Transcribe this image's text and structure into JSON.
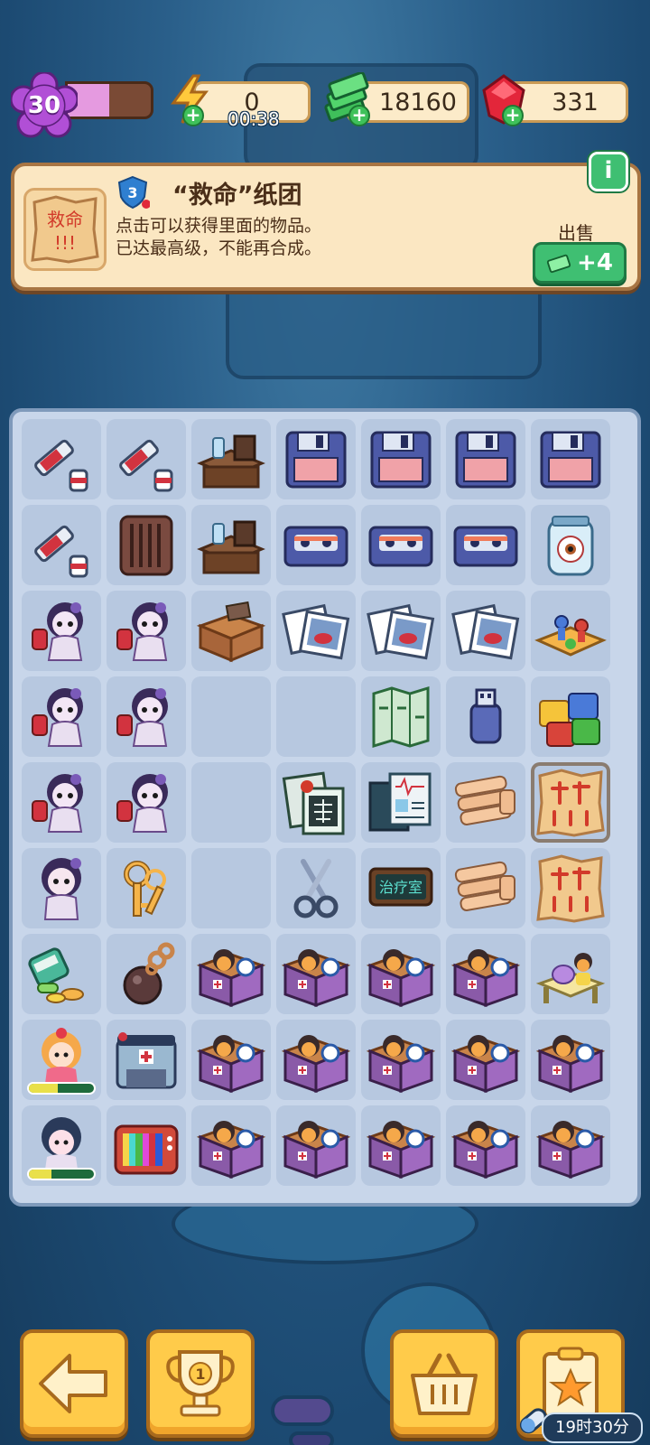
{
  "hud": {
    "level": "30",
    "xp_progress": 0.5,
    "energy": "0",
    "energy_timer": "00:38",
    "cash": "18160",
    "gems": "331"
  },
  "item_info": {
    "item_level": "3",
    "title": "“救命”纸团",
    "desc_line1": "点击可以获得里面的物品。",
    "desc_line2": "已达最高级，不能再合成。",
    "thumb_text": "救命",
    "thumb_marks": "!!!",
    "sell_label": "出售",
    "sell_value": "+4",
    "info_label": "i"
  },
  "grid_icons": [
    [
      "syringe-icon",
      "syringe-icon",
      "desk-icon",
      "floppy-disk-icon",
      "floppy-disk-icon",
      "floppy-disk-icon",
      "floppy-disk-icon"
    ],
    [
      "syringe-icon",
      "cage-icon",
      "desk-icon",
      "cassette-icon",
      "cassette-icon",
      "cassette-icon",
      "eye-jar-icon"
    ],
    [
      "nurse-ghost-icon",
      "nurse-ghost-icon",
      "box-icon",
      "photo-icon",
      "photo-icon",
      "photo-icon",
      "board-game-icon"
    ],
    [
      "nurse-ghost-icon",
      "nurse-ghost-icon",
      "",
      "",
      "map-icon",
      "usb-drive-icon",
      "puzzle-icon"
    ],
    [
      "nurse-ghost-icon",
      "nurse-ghost-icon",
      "",
      "xray-icon",
      "medical-file-icon",
      "bandage-icon",
      "paper-ball-icon"
    ],
    [
      "girl-icon",
      "keys-icon",
      "",
      "scissors-icon",
      "sign-icon",
      "bandage-icon",
      "paper-ball-icon"
    ],
    [
      "pills-icon",
      "ball-chain-icon",
      "treasure-box-icon",
      "treasure-box-icon",
      "treasure-box-icon",
      "treasure-box-icon",
      "bed-icon"
    ],
    [
      "customer-girl-icon",
      "ambulance-icon",
      "treasure-box-icon",
      "treasure-box-icon",
      "treasure-box-icon",
      "treasure-box-icon",
      "treasure-box-icon"
    ],
    [
      "customer-boy-icon",
      "tv-icon",
      "treasure-box-icon",
      "treasure-box-icon",
      "treasure-box-icon",
      "treasure-box-icon",
      "treasure-box-icon"
    ]
  ],
  "sign_text": "治疗室",
  "customer_progress": [
    0.45,
    0.35
  ],
  "bottom": {
    "trophy_number": "1",
    "timer": "19时30分"
  },
  "colors": {
    "panel_bg": "#fbe7c2",
    "board_bg": "#c8d6ea",
    "cell_bg": "#b7c8e0",
    "sell_green": "#3fbf72",
    "button_yellow": "#ffcb4a",
    "level_purple": "#b14fd6"
  }
}
